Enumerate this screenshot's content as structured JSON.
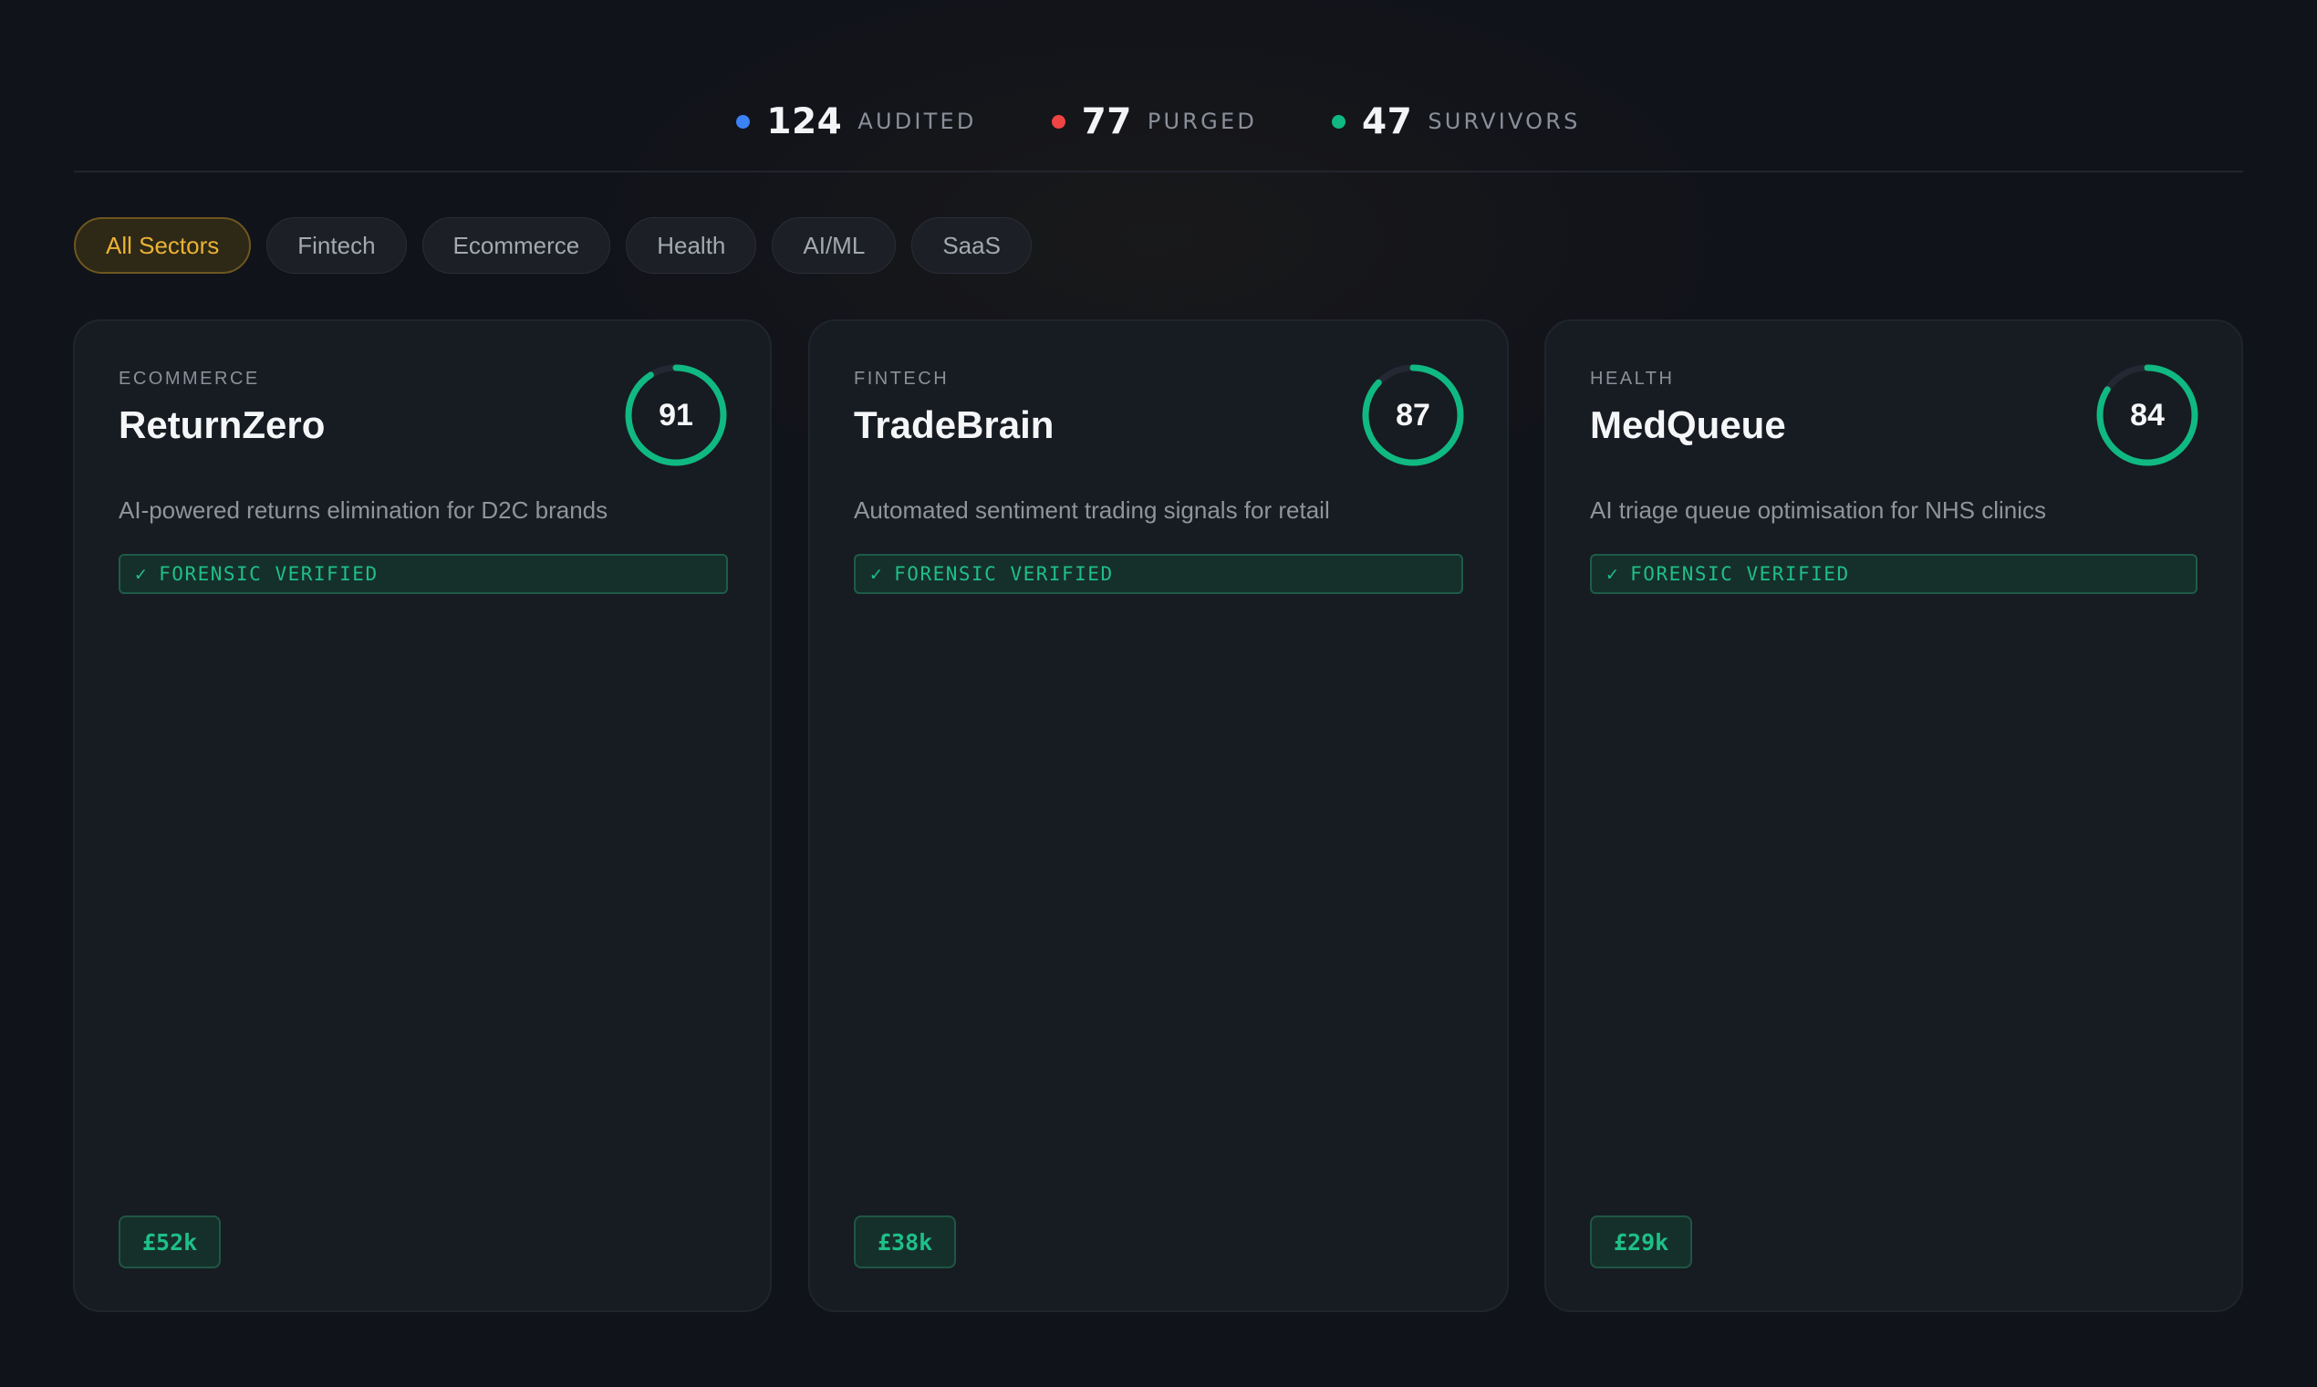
{
  "stats": [
    {
      "value": "124",
      "label": "AUDITED",
      "color": "#3b82f6"
    },
    {
      "value": "77",
      "label": "PURGED",
      "color": "#ef4444"
    },
    {
      "value": "47",
      "label": "SURVIVORS",
      "color": "#10b981"
    }
  ],
  "filters": [
    "All Sectors",
    "Fintech",
    "Ecommerce",
    "Health",
    "AI/ML",
    "SaaS"
  ],
  "active_filter": "All Sectors",
  "badge_label": "FORENSIC VERIFIED",
  "badge_icon": "check-icon",
  "cards": [
    {
      "sector": "ECOMMERCE",
      "name": "ReturnZero",
      "score": "91",
      "description": "AI-powered returns elimination for D2C brands",
      "price": "£52k"
    },
    {
      "sector": "FINTECH",
      "name": "TradeBrain",
      "score": "87",
      "description": "Automated sentiment trading signals for retail",
      "price": "£38k"
    },
    {
      "sector": "HEALTH",
      "name": "MedQueue",
      "score": "84",
      "description": "AI triage queue optimisation for NHS clinics",
      "price": "£29k"
    }
  ],
  "colors": {
    "accent": "#eab335",
    "verified": "#10b981",
    "background": "#11131a"
  }
}
